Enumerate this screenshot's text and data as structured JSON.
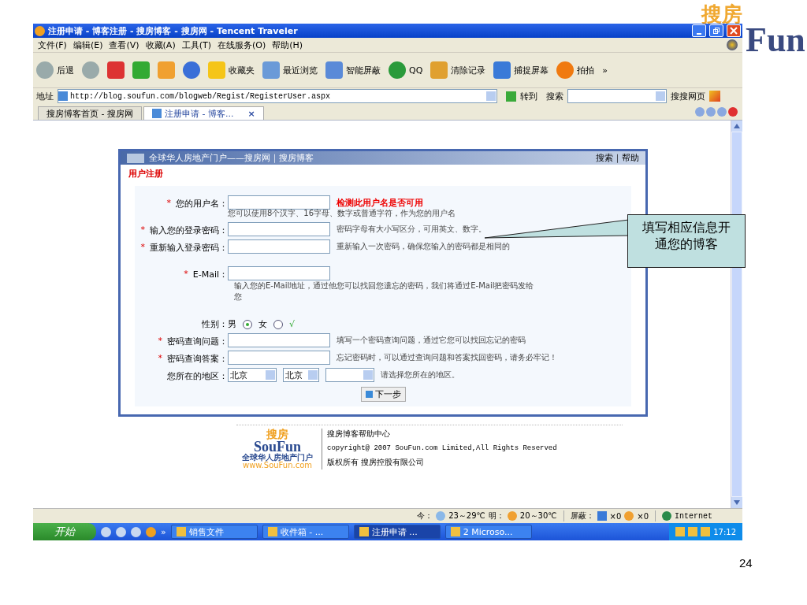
{
  "slide": {
    "logo_top": "搜房",
    "logo_bottom": "Fun",
    "page_number": "24"
  },
  "window": {
    "title": "注册申请 - 博客注册 - 搜房博客 - 搜房网 - Tencent Traveler"
  },
  "menu": [
    "文件(F)",
    "编辑(E)",
    "查看(V)",
    "收藏(A)",
    "工具(T)",
    "在线服务(O)",
    "帮助(H)"
  ],
  "toolbar": [
    {
      "kind": "back",
      "label": "后退"
    },
    {
      "kind": "forward"
    },
    {
      "kind": "stop"
    },
    {
      "kind": "refresh"
    },
    {
      "kind": "home"
    },
    {
      "kind": "history"
    },
    {
      "kind": "favorites",
      "label": "收藏夹"
    },
    {
      "kind": "recent",
      "label": "最近浏览"
    },
    {
      "kind": "block",
      "label": "智能屏蔽"
    },
    {
      "kind": "qq",
      "label": "QQ"
    },
    {
      "kind": "clear",
      "label": "清除记录"
    },
    {
      "kind": "capture",
      "label": "捕捉屏幕"
    },
    {
      "kind": "paipai",
      "label": "拍拍"
    }
  ],
  "toolbar_more": "»",
  "address": {
    "label": "地址",
    "url": "http://blog.soufun.com/blogweb/Regist/RegisterUser.aspx",
    "go": "转到",
    "search_label": "搜索",
    "search_engine": "搜搜网页"
  },
  "tabs": [
    {
      "label": "搜房博客首页 - 搜房网",
      "selected": false
    },
    {
      "label": "注册申请 - 博客...",
      "selected": true,
      "close": "×"
    }
  ],
  "page": {
    "site_title": "全球华人房地产门户——搜房网｜搜房博客",
    "header_links": "搜索｜帮助",
    "heading": "用户注册",
    "required_mark": "*",
    "fields": [
      {
        "kind": "text",
        "required": true,
        "label": "您的用户名：",
        "check": "检测此用户名是否可用",
        "note": "您可以使用8个汉字、16字母、数字或普通字符，作为您的用户名"
      },
      {
        "kind": "text",
        "required": true,
        "label": "输入您的登录密码：",
        "hint": "密码字母有大小写区分，可用英文、数字。"
      },
      {
        "kind": "text",
        "required": true,
        "label": "重新输入登录密码：",
        "hint": "重新输入一次密码，确保您输入的密码都是相同的"
      },
      {
        "kind": "email",
        "required": true,
        "label": "E-Mail：",
        "hint": "输入您的E-Mail地址，通过他您可以找回您遗忘的密码，我们将通过E-Mail把密码发给您"
      },
      {
        "kind": "radio",
        "required": false,
        "label": "性别：",
        "options": [
          {
            "label": "男",
            "selected": true
          },
          {
            "label": "女",
            "selected": false
          }
        ],
        "valid": "√"
      },
      {
        "kind": "text",
        "required": true,
        "label": "密码查询问题：",
        "hint": "填写一个密码查询问题，通过它您可以找回忘记的密码"
      },
      {
        "kind": "text",
        "required": true,
        "label": "密码查询答案：",
        "hint": "忘记密码时，可以通过查询问题和答案找回密码，请务必牢记！"
      },
      {
        "kind": "select",
        "required": false,
        "label": "您所在的地区：",
        "selects": [
          {
            "kind": "filled",
            "value": "北京"
          },
          {
            "kind": "filled",
            "value": "北京"
          },
          {
            "kind": "blank"
          }
        ],
        "hint": "请选择您所在的地区。"
      }
    ],
    "next_button": "下一步"
  },
  "footer": {
    "logo_cn": "搜房",
    "logo_en": "SouFun",
    "logo_slogan": "全球华人房地产门户",
    "logo_url": "www.SouFun.com",
    "help": "搜房博客帮助中心",
    "copyright": "copyright@ 2007 SouFun.com Limited,All Rights Reserved",
    "owner": "版权所有 搜房控股有限公司"
  },
  "callout": {
    "text": "填写相应信息开通您的博客"
  },
  "status_bar": {
    "today_label": "今：",
    "today_temp": "23～29℃",
    "tomorrow_label": "明：",
    "tomorrow_temp": "20～30℃",
    "blocked_label": "屏蔽：",
    "popups": "×0",
    "ads": "×0",
    "zone": "Internet"
  },
  "taskbar": {
    "start": "开始",
    "more": "»",
    "tasks": [
      {
        "label": "销售文件",
        "selected": false
      },
      {
        "label": "收件箱 - ...",
        "selected": false
      },
      {
        "label": "注册申请 ...",
        "selected": true
      },
      {
        "label": "2 Microso...",
        "selected": false
      }
    ],
    "clock": "17:12"
  }
}
